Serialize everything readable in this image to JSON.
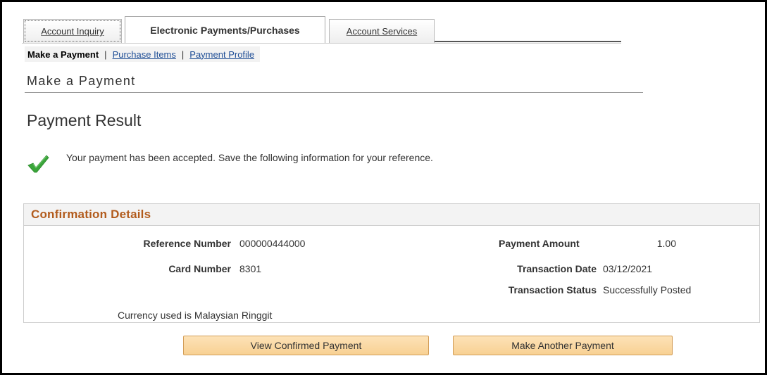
{
  "tabs": [
    {
      "label": "Account Inquiry",
      "state": "inactive"
    },
    {
      "label": "Electronic Payments/Purchases",
      "state": "active"
    },
    {
      "label": "Account Services",
      "state": "inactive"
    }
  ],
  "subnav": {
    "current": "Make a Payment",
    "separator": "|",
    "links": [
      "Purchase Items",
      "Payment Profile"
    ]
  },
  "page": {
    "header": "Make a Payment",
    "result_title": "Payment Result",
    "result_message": "Your payment has been accepted. Save the following information for your reference.",
    "result_icon": "checkmark-icon"
  },
  "confirmation": {
    "title": "Confirmation Details",
    "reference_number": {
      "label": "Reference Number",
      "value": "000000444000"
    },
    "card_number": {
      "label": "Card Number",
      "value": "8301"
    },
    "payment_amount": {
      "label": "Payment Amount",
      "value": "1.00"
    },
    "transaction_date": {
      "label": "Transaction Date",
      "value": "03/12/2021"
    },
    "transaction_status": {
      "label": "Transaction Status",
      "value": "Successfully Posted"
    },
    "currency_note": "Currency used is Malaysian Ringgit"
  },
  "buttons": {
    "view_confirmed": "View Confirmed Payment",
    "make_another": "Make Another Payment"
  },
  "colors": {
    "section_title": "#b25b1c",
    "link": "#1f4e96",
    "button_bg": "#f8d193",
    "check": "#3aa53a"
  }
}
